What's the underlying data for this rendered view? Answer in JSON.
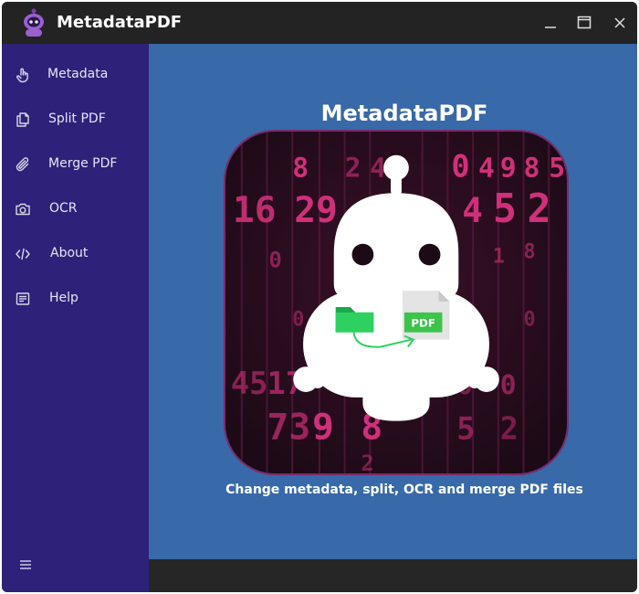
{
  "window": {
    "title": "MetadataPDF",
    "controls": [
      "minimize",
      "maximize",
      "close"
    ]
  },
  "sidebar": {
    "items": [
      {
        "label": "Metadata",
        "icon": "touch-icon"
      },
      {
        "label": "Split PDF",
        "icon": "copy-icon"
      },
      {
        "label": "Merge PDF",
        "icon": "paperclip-icon"
      },
      {
        "label": "OCR",
        "icon": "camera-icon"
      },
      {
        "label": "About",
        "icon": "code-icon"
      },
      {
        "label": "Help",
        "icon": "document-icon"
      }
    ],
    "menu_icon": "hamburger-menu-icon"
  },
  "main": {
    "hero_title": "MetadataPDF",
    "pdf_badge": "PDF",
    "tagline": "Change metadata, split, OCR and merge PDF files"
  },
  "colors": {
    "titlebar": "#232323",
    "sidebar": "#2d2179",
    "main_background": "#3869a8",
    "bottom_bar": "#262626",
    "hero_background": "#2a0d1e",
    "hero_digits": "#d0307a",
    "pdf_badge": "#3cc44a"
  }
}
